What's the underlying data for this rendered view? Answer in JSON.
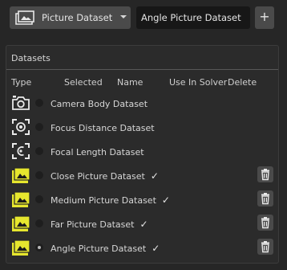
{
  "toolbar": {
    "dataset_select_value": "Picture Dataset",
    "new_name_value": "Angle Picture Dataset",
    "add_label": "+"
  },
  "panel": {
    "title": "Datasets",
    "columns": {
      "type": "Type",
      "selected": "Selected",
      "name": "Name",
      "use_in_solver": "Use In Solver",
      "delete": "Delete"
    }
  },
  "datasets": [
    {
      "name": "Camera Body Dataset",
      "icon": "camera-icon",
      "selected": false,
      "use_in_solver": "",
      "deletable": false
    },
    {
      "name": "Focus Distance Dataset",
      "icon": "focus-distance-icon",
      "selected": false,
      "use_in_solver": "",
      "deletable": false
    },
    {
      "name": "Focal Length Dataset",
      "icon": "focal-length-icon",
      "selected": false,
      "use_in_solver": "",
      "deletable": false
    },
    {
      "name": "Close Picture Dataset",
      "icon": "picture-folder-icon",
      "selected": false,
      "use_in_solver": "✓",
      "deletable": true
    },
    {
      "name": "Medium Picture Dataset",
      "icon": "picture-folder-icon",
      "selected": false,
      "use_in_solver": "✓",
      "deletable": true
    },
    {
      "name": "Far Picture Dataset",
      "icon": "picture-folder-icon",
      "selected": false,
      "use_in_solver": "✓",
      "deletable": true
    },
    {
      "name": "Angle Picture Dataset",
      "icon": "picture-folder-icon",
      "selected": true,
      "use_in_solver": "✓",
      "deletable": true
    }
  ],
  "colors": {
    "accent_yellow": "#e6e62e",
    "background": "#262626",
    "panel": "#2b2b2b"
  }
}
